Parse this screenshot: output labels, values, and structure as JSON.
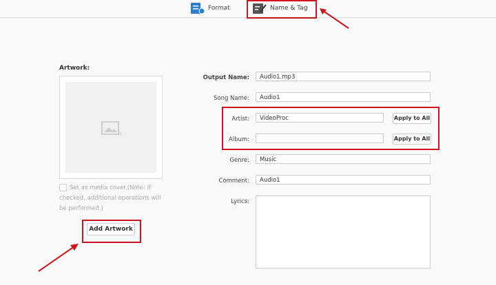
{
  "tabs": [
    {
      "label": "Format",
      "icon": "format-settings-icon"
    },
    {
      "label": "Name & Tag",
      "icon": "edit-tag-icon"
    }
  ],
  "artwork": {
    "label": "Artwork:",
    "checkbox_text": "Set as media cover.(Note: If checked, additional operations will be performed.)",
    "add_button": "Add Artwork"
  },
  "fields": {
    "output_name": {
      "label": "Output Name:",
      "value": "Audio1.mp3"
    },
    "song_name": {
      "label": "Song Name:",
      "value": "Audio1"
    },
    "artist": {
      "label": "Artist:",
      "value": "VideoProc"
    },
    "album": {
      "label": "Album:",
      "value": ""
    },
    "genre": {
      "label": "Genre:",
      "value": "Music"
    },
    "comment": {
      "label": "Comment:",
      "value": "Audio1"
    },
    "lyrics": {
      "label": "Lyrics:",
      "value": ""
    }
  },
  "apply_all": "Apply to All"
}
